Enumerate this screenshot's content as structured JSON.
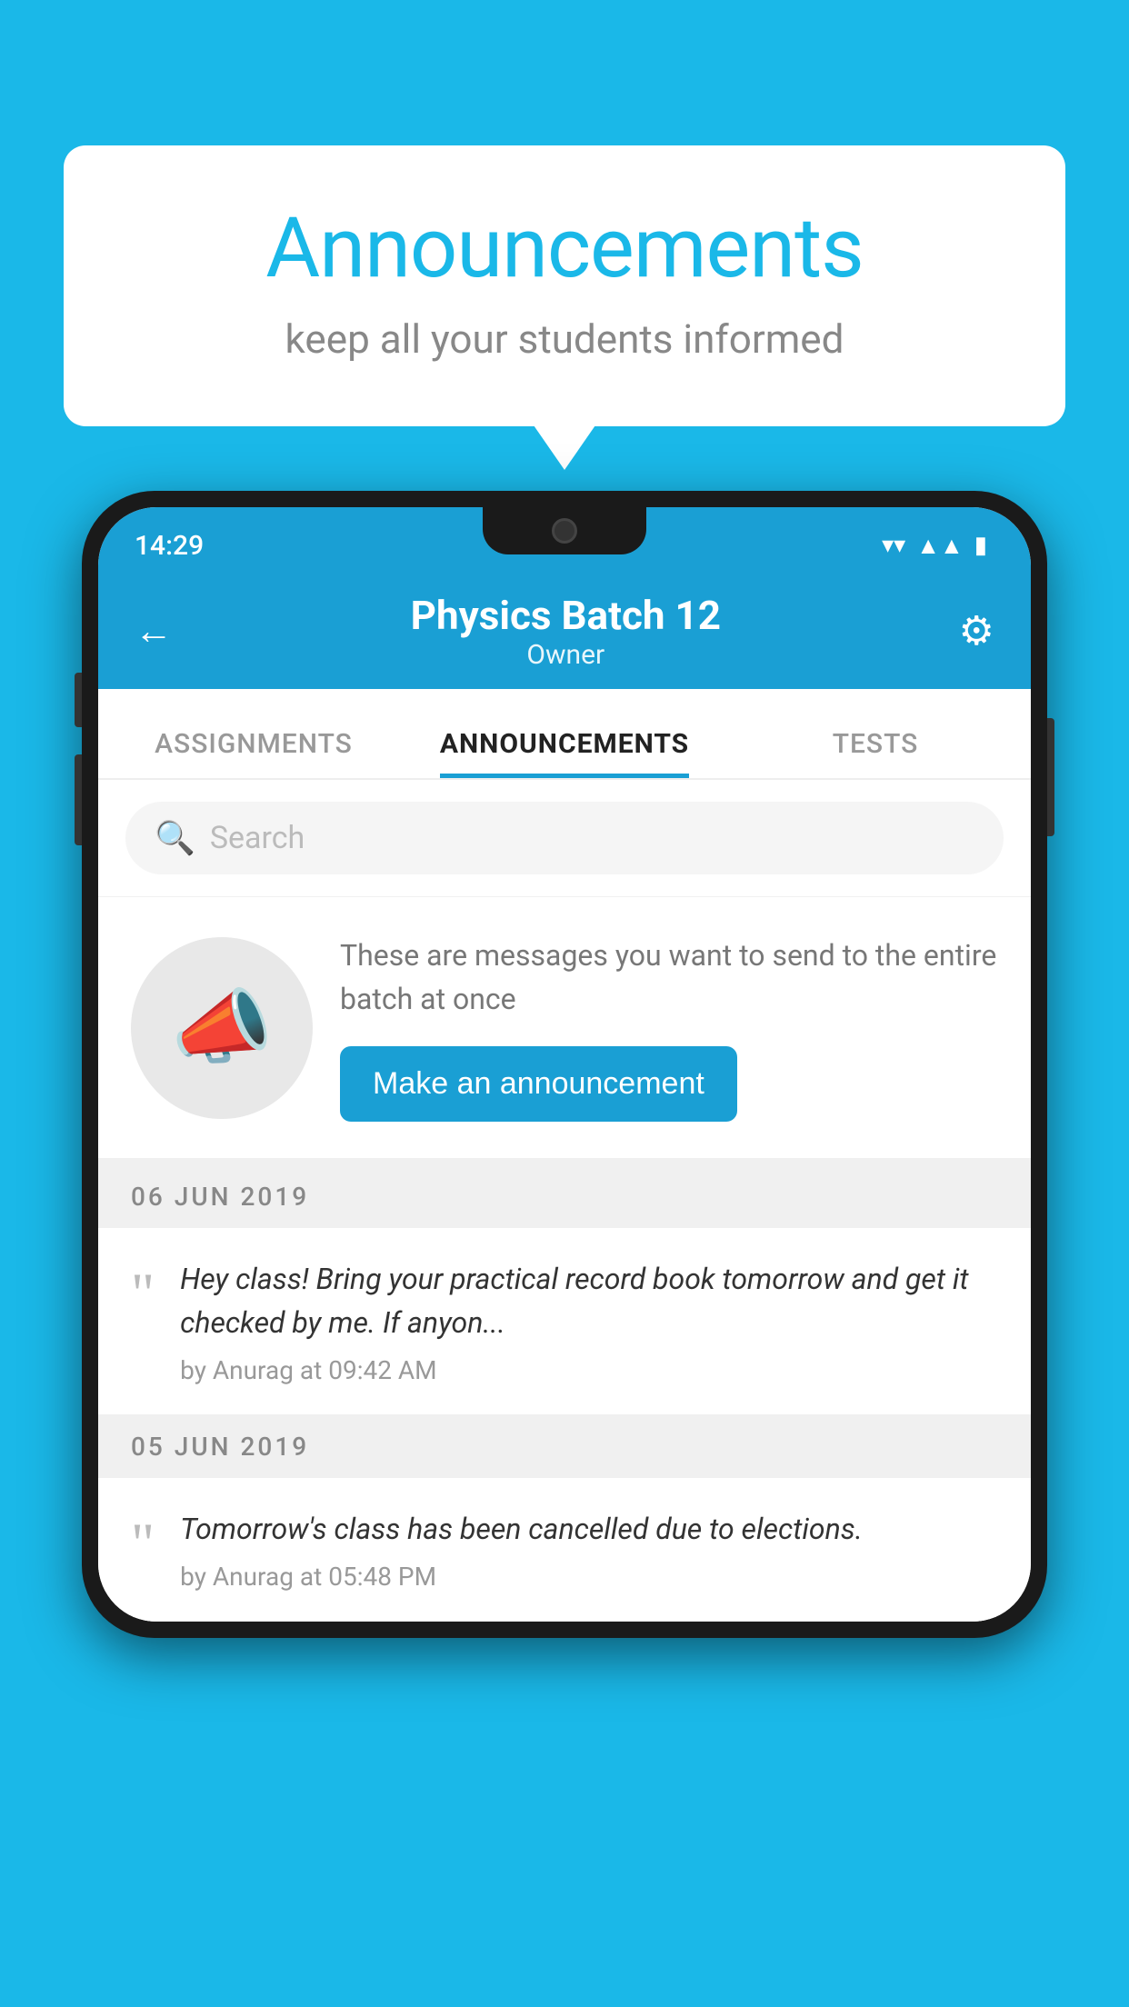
{
  "bubble": {
    "title": "Announcements",
    "subtitle": "keep all your students informed"
  },
  "phone": {
    "status_bar": {
      "time": "14:29"
    },
    "header": {
      "title": "Physics Batch 12",
      "subtitle": "Owner",
      "back_label": "←",
      "gear_label": "⚙"
    },
    "tabs": [
      {
        "label": "ASSIGNMENTS",
        "active": false
      },
      {
        "label": "ANNOUNCEMENTS",
        "active": true
      },
      {
        "label": "TESTS",
        "active": false
      }
    ],
    "search": {
      "placeholder": "Search"
    },
    "promo": {
      "description": "These are messages you want to send to the entire batch at once",
      "button_label": "Make an announcement"
    },
    "announcements": [
      {
        "date": "06  JUN  2019",
        "text": "Hey class! Bring your practical record book tomorrow and get it checked by me. If anyon...",
        "meta": "by Anurag at 09:42 AM"
      },
      {
        "date": "05  JUN  2019",
        "text": "Tomorrow's class has been cancelled due to elections.",
        "meta": "by Anurag at 05:48 PM"
      }
    ]
  },
  "icons": {
    "megaphone": "📣",
    "quote": "““"
  }
}
